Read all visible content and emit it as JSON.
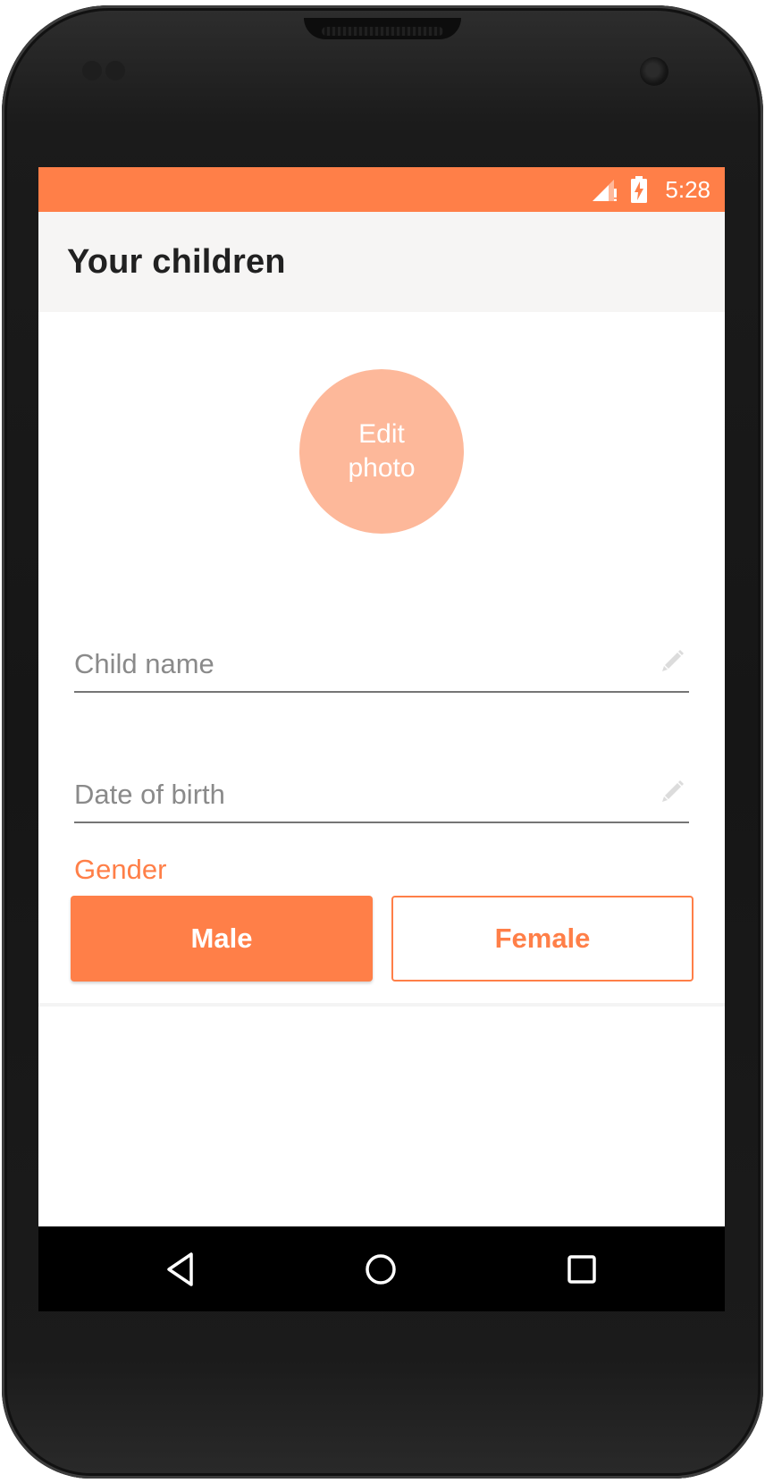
{
  "status_bar": {
    "time": "5:28",
    "color": "#FF7F48",
    "icons": [
      "signal-icon",
      "battery-charging-icon"
    ]
  },
  "app_bar": {
    "title": "Your children"
  },
  "photo": {
    "label": "Edit photo"
  },
  "form": {
    "child_name": {
      "placeholder": "Child name",
      "value": "",
      "icon": "pencil-icon"
    },
    "date_of_birth": {
      "placeholder": "Date of birth",
      "value": "",
      "icon": "pencil-icon"
    },
    "gender": {
      "label": "Gender",
      "options": [
        "Male",
        "Female"
      ],
      "selected": "Male"
    }
  },
  "nav_bar": {
    "buttons": [
      "back-icon",
      "home-icon",
      "recents-icon"
    ]
  },
  "colors": {
    "accent": "#FF7F48",
    "photo_circle": "#FDB89A",
    "app_bar_background": "#F6F5F4"
  }
}
